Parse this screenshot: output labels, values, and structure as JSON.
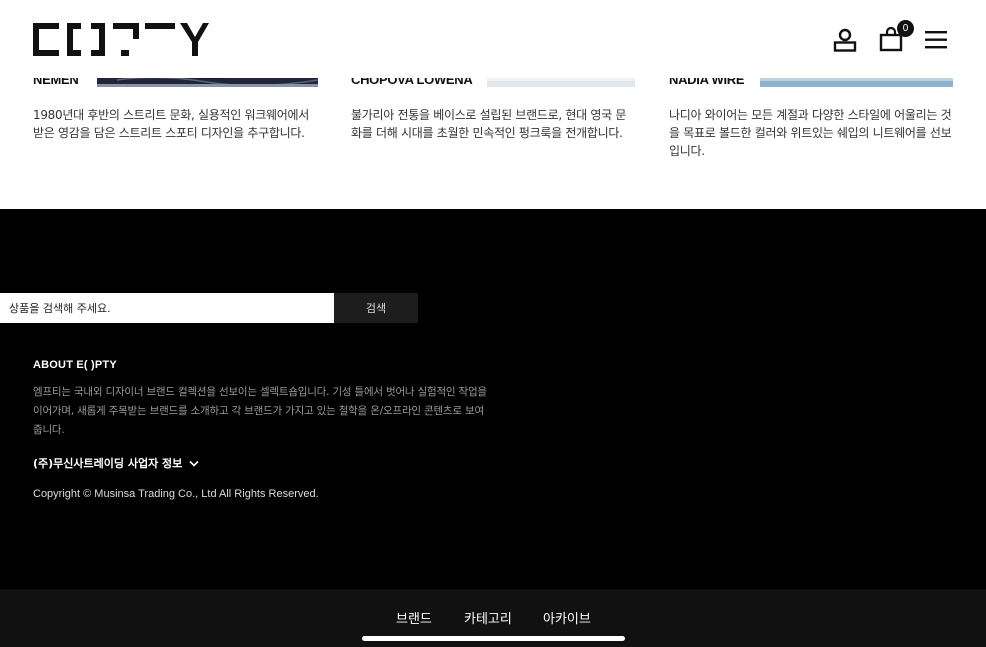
{
  "header": {
    "logo_text": "E( )PTY",
    "cart_count": "0",
    "icons": [
      "user-icon",
      "cart-icon",
      "menu-icon"
    ]
  },
  "brands": [
    {
      "name": "NEMEN",
      "description": "1980년대 후반의 스트리트 문화, 실용적인 워크웨어에서 받은 영감을 담은 스트리트 스포티 디자인을 추구합니다."
    },
    {
      "name": "CHOPOVA LOWENA",
      "description": "불가리아 전통을 베이스로 설립된 브랜드로, 현대 영국 문화를 더해 시대를 초월한 민속적인 펑크룩을 전개합니다."
    },
    {
      "name": "NADIA WIRE",
      "description": "나디아 와이어는 모든 계절과 다양한 스타일에 어울리는 것을 목표로 볼드한 컬러와 위트있는 쉐입의 니트웨어를 선보입니다."
    }
  ],
  "footer": {
    "search": {
      "placeholder": "상품을 검색해 주세요.",
      "value": "",
      "button_label": "검색"
    },
    "about_title": "ABOUT E( )PTY",
    "about_text": "엠프티는 국내외 디자이너 브랜드 컬렉션을 선보이는 셀렉트숍입니다. 기성 틀에서 벗어나 실험적인 작업을 이어가며, 새롭게 주목받는 브랜드를 소개하고 각 브랜드가 가지고 있는 철학을 온/오프라인 콘텐츠로 보여줍니다.",
    "business_info_label": "(주)무신사트레이딩 사업자 정보",
    "copyright": "Copyright © Musinsa Trading Co., Ltd All Rights Reserved."
  },
  "bottom_nav": {
    "items": [
      {
        "label": "브랜드"
      },
      {
        "label": "카테고리"
      },
      {
        "label": "아카이브"
      }
    ]
  },
  "colors": {
    "footer_bg": "#000000",
    "nav_bg": "#111111",
    "search_button_bg": "#1d1d1d",
    "muted_text": "#9a9a9a"
  }
}
